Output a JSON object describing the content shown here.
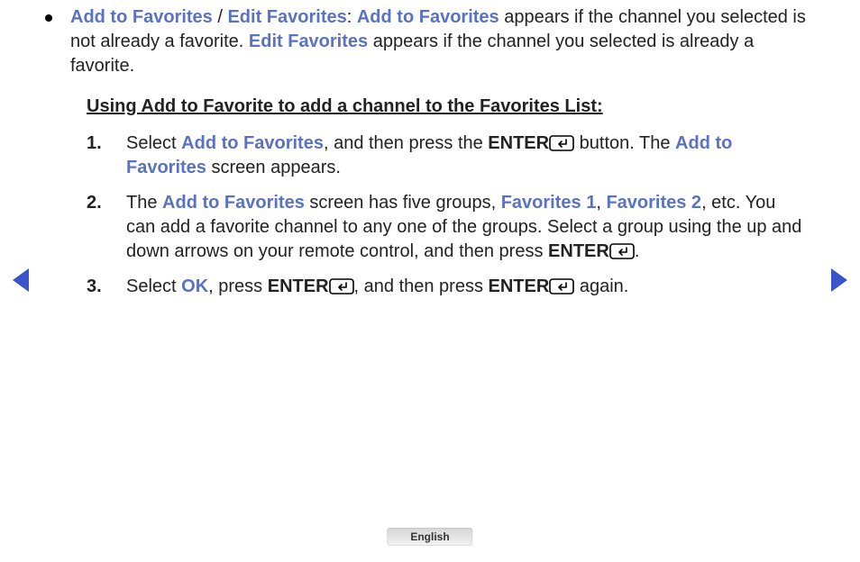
{
  "bullet": {
    "hl1": "Add to Favorites",
    "slash": " / ",
    "hl2": "Edit Favorites",
    "colon": ": ",
    "hl3": "Add to Favorites",
    "t1": " appears if the channel you selected is not already a favorite. ",
    "hl4": "Edit Favorites",
    "t2": " appears if the channel you selected is already a favorite."
  },
  "section_title": "Using Add to Favorite to add a channel to the Favorites List:",
  "steps": {
    "s1": {
      "num": "1.",
      "a": "Select ",
      "hl1": "Add to Favorites",
      "b": ", and then press the ",
      "enter": "ENTER",
      "c": " button. The ",
      "hl2": "Add to Favorites",
      "d": " screen appears."
    },
    "s2": {
      "num": "2.",
      "a": "The ",
      "hl1": "Add to Favorites",
      "b": " screen has five groups, ",
      "hl2": "Favorites 1",
      "c": ", ",
      "hl3": "Favorites 2",
      "d": ", etc. You can add a favorite channel to any one of the groups. Select a group using the up and down arrows on your remote control, and then press ",
      "enter": "ENTER",
      "e": "."
    },
    "s3": {
      "num": "3.",
      "a": "Select ",
      "hl1": "OK",
      "b": ", press ",
      "enter1": "ENTER",
      "c": ", and then press ",
      "enter2": "ENTER",
      "d": " again."
    }
  },
  "language": "English"
}
